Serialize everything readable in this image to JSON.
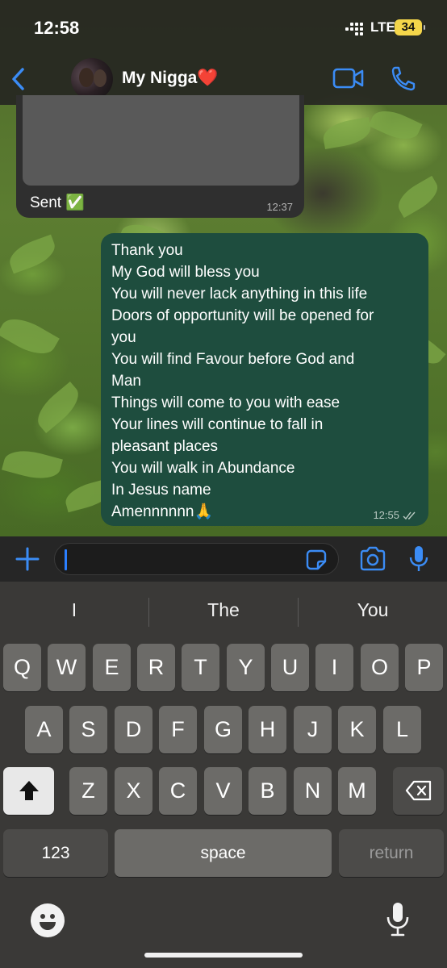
{
  "status_bar": {
    "time": "12:58",
    "network": "LTE",
    "battery": "34"
  },
  "header": {
    "contact_name": "My Nigga❤️"
  },
  "messages": {
    "incoming": {
      "text": "Sent ✅",
      "time": "12:37"
    },
    "outgoing": {
      "lines": [
        "Thank you",
        "My God will bless you",
        "You will never lack anything in this life",
        "Doors of opportunity will be opened for",
        "you",
        "You will find Favour before God and",
        "Man",
        "Things will come to you with ease",
        "Your lines will continue to fall in",
        "pleasant places",
        "You will walk in Abundance",
        "In Jesus name",
        "Amennnnnn🙏"
      ],
      "time": "12:55"
    }
  },
  "composer": {
    "value": ""
  },
  "keyboard": {
    "suggestions": [
      "I",
      "The",
      "You"
    ],
    "row1": [
      "Q",
      "W",
      "E",
      "R",
      "T",
      "Y",
      "U",
      "I",
      "O",
      "P"
    ],
    "row2": [
      "A",
      "S",
      "D",
      "F",
      "G",
      "H",
      "J",
      "K",
      "L"
    ],
    "row3": [
      "Z",
      "X",
      "C",
      "V",
      "B",
      "N",
      "M"
    ],
    "numbers_label": "123",
    "space_label": "space",
    "return_label": "return"
  },
  "colors": {
    "accent": "#2b7fff",
    "outgoing_bubble": "#1e4d3e",
    "incoming_bubble": "#2f2f2f"
  }
}
